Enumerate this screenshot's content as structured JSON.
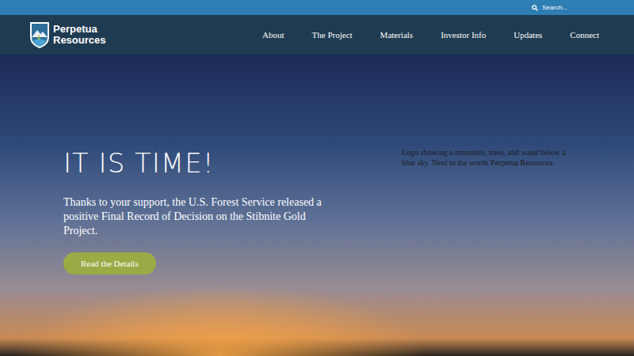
{
  "top_bar": {
    "search": {
      "placeholder": "Search..."
    }
  },
  "logo": {
    "line1": "Perpetua",
    "line2": "Resources"
  },
  "nav": {
    "items": [
      "About",
      "The Project",
      "Materials",
      "Investor Info",
      "Updates",
      "Connect"
    ]
  },
  "hero": {
    "heading": "IT IS TIME!",
    "text": "Thanks to your support, the U.S. Forest Service released a positive Final Record of Decision on the Stibnite Gold Project.",
    "button": "Read the Details",
    "image_alt": "Logo showing a mountain, trees, and water below a blue sky. Next to the words Perpetua Resources."
  }
}
